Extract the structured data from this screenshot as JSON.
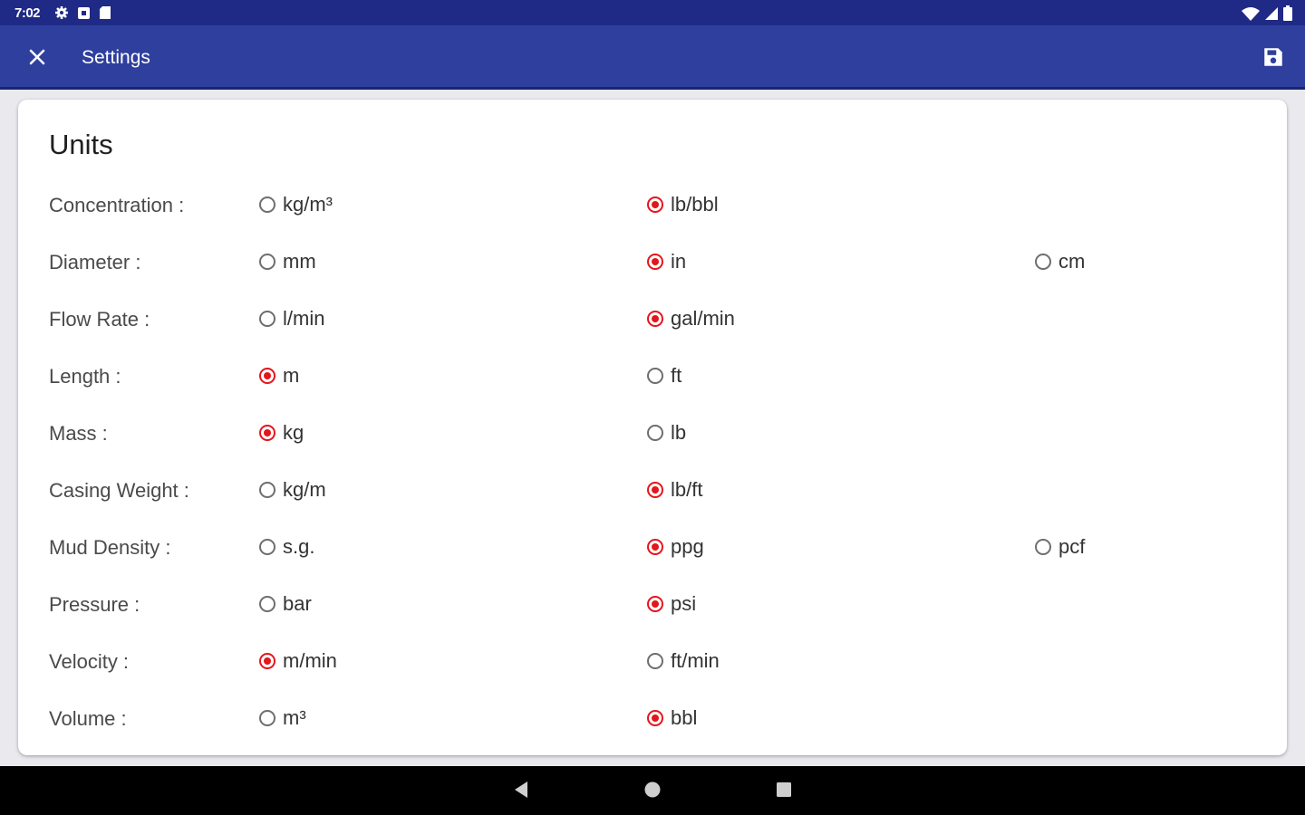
{
  "status_bar": {
    "time": "7:02",
    "left_icons": [
      "gear-icon",
      "notification-square-icon",
      "sd-card-icon"
    ],
    "right_icons": [
      "wifi-icon",
      "cell-signal-icon",
      "battery-icon"
    ]
  },
  "app_bar": {
    "title": "Settings",
    "close_icon": "close-icon",
    "save_icon": "save-icon",
    "color": "#2f3f9e"
  },
  "card": {
    "title": "Units",
    "rows": [
      {
        "label": "Concentration :",
        "options": [
          "kg/m³",
          "lb/bbl"
        ],
        "selected": 1
      },
      {
        "label": "Diameter :",
        "options": [
          "mm",
          "in",
          "cm"
        ],
        "selected": 1
      },
      {
        "label": "Flow Rate :",
        "options": [
          "l/min",
          "gal/min"
        ],
        "selected": 1
      },
      {
        "label": "Length :",
        "options": [
          "m",
          "ft"
        ],
        "selected": 0
      },
      {
        "label": "Mass :",
        "options": [
          "kg",
          "lb"
        ],
        "selected": 0
      },
      {
        "label": "Casing Weight :",
        "options": [
          "kg/m",
          "lb/ft"
        ],
        "selected": 1
      },
      {
        "label": "Mud Density :",
        "options": [
          "s.g.",
          "ppg",
          "pcf"
        ],
        "selected": 1
      },
      {
        "label": "Pressure :",
        "options": [
          "bar",
          "psi"
        ],
        "selected": 1
      },
      {
        "label": "Velocity :",
        "options": [
          "m/min",
          "ft/min"
        ],
        "selected": 0
      },
      {
        "label": "Volume :",
        "options": [
          "m³",
          "bbl"
        ],
        "selected": 1
      }
    ]
  },
  "accent_color": "#e4161b",
  "nav_bar": {
    "icons": [
      "back-icon",
      "home-icon",
      "recents-icon"
    ]
  }
}
